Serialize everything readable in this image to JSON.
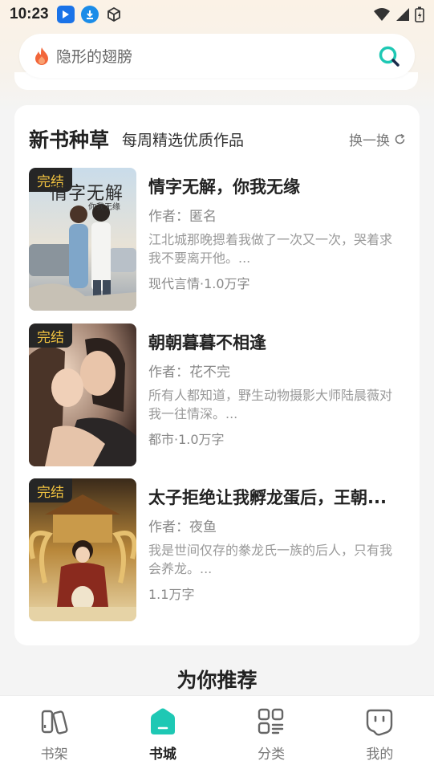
{
  "status_bar": {
    "time": "10:23"
  },
  "search": {
    "placeholder": "隐形的翅膀"
  },
  "section": {
    "title": "新书种草",
    "subtitle": "每周精选优质作品",
    "refresh_label": "换一换"
  },
  "books": [
    {
      "badge": "完结",
      "title": "情字无解，你我无缘",
      "author": "作者：匿名",
      "desc": "江北城那晚摁着我做了一次又一次，哭着求我不要离开他。...",
      "meta": "现代言情·1.0万字",
      "cover_text": "情字无解",
      "cover_subtext": "你我无缘"
    },
    {
      "badge": "完结",
      "title": "朝朝暮暮不相逢",
      "author": "作者：花不完",
      "desc": "所有人都知道，野生动物摄影大师陆晨薇对我一往情深。...",
      "meta": "都市·1.0万字"
    },
    {
      "badge": "完结",
      "title": "太子拒绝让我孵龙蛋后，王朝...",
      "author": "作者：夜鱼",
      "desc": "我是世间仅存的豢龙氏一族的后人，只有我会养龙。...",
      "meta": "1.1万字"
    }
  ],
  "recommend_title": "为你推荐",
  "tabs": [
    {
      "label": "书架",
      "icon": "bookshelf-icon"
    },
    {
      "label": "书城",
      "icon": "bookstore-icon",
      "active": true
    },
    {
      "label": "分类",
      "icon": "category-icon"
    },
    {
      "label": "我的",
      "icon": "profile-icon"
    }
  ],
  "colors": {
    "accent": "#1ec8b4",
    "badge_text": "#f0c240",
    "flame": "#f2663a"
  }
}
